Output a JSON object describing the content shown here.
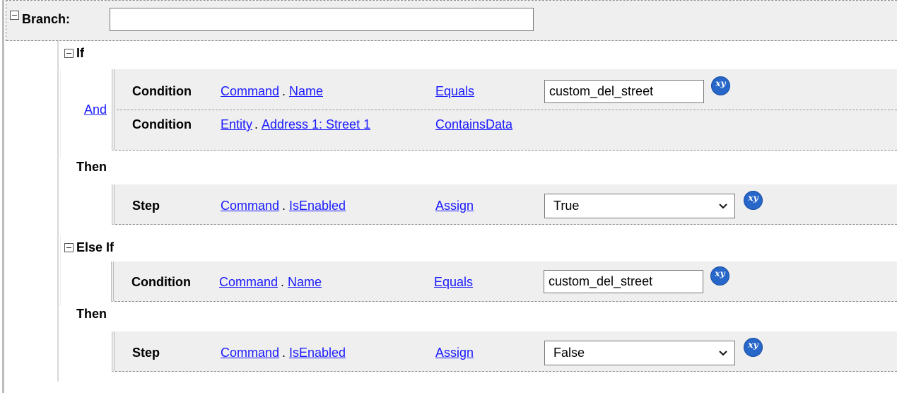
{
  "branch": {
    "label": "Branch:",
    "value": ""
  },
  "if": {
    "header": "If",
    "operator": "And",
    "conditions": [
      {
        "kind": "Condition",
        "source": "Command",
        "property": "Name",
        "op": "Equals",
        "value": "custom_del_street",
        "has_value": true
      },
      {
        "kind": "Condition",
        "source": "Entity",
        "property": "Address 1: Street 1",
        "op": "ContainsData"
      }
    ],
    "then_label": "Then",
    "step": {
      "kind": "Step",
      "source": "Command",
      "property": "IsEnabled",
      "op": "Assign",
      "value": "True"
    }
  },
  "elseif": {
    "header": "Else If",
    "condition": {
      "kind": "Condition",
      "source": "Command",
      "property": "Name",
      "op": "Equals",
      "value": "custom_del_street"
    },
    "then_label": "Then",
    "step": {
      "kind": "Step",
      "source": "Command",
      "property": "IsEnabled",
      "op": "Assign",
      "value": "False"
    }
  },
  "dot": ".",
  "variable_button_label": "xy"
}
